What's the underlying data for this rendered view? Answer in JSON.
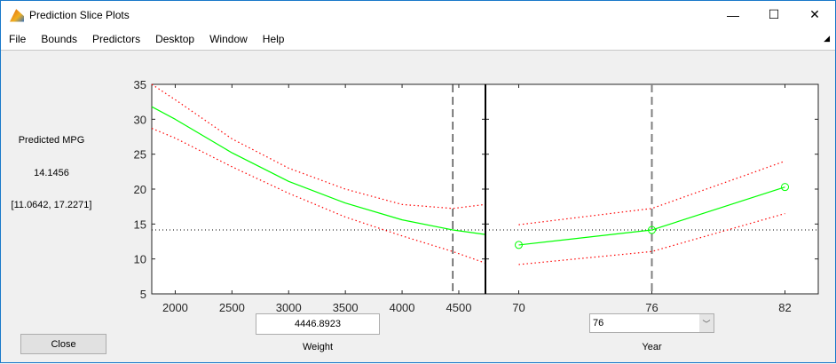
{
  "window": {
    "title": "Prediction Slice Plots",
    "minimize": "—",
    "maximize": "☐",
    "close": "✕"
  },
  "menu": [
    "File",
    "Bounds",
    "Predictors",
    "Desktop",
    "Window",
    "Help"
  ],
  "left_panel": {
    "label": "Predicted MPG",
    "value": "14.1456",
    "interval": "[11.0642, 17.2271]",
    "close_button": "Close"
  },
  "controls": {
    "weight_value": "4446.8923",
    "weight_label": "Weight",
    "year_value": "76",
    "year_label": "Year"
  },
  "chart_data": [
    {
      "type": "line",
      "xlabel": "Weight",
      "xlim": [
        1793,
        4735
      ],
      "ylim": [
        5,
        35
      ],
      "xticks": [
        2000,
        2500,
        3000,
        3500,
        4000,
        4500
      ],
      "yticks": [
        5,
        10,
        15,
        20,
        25,
        30,
        35
      ],
      "current_x": 4446.8923,
      "current_y": 14.1456,
      "x": [
        1793,
        2000,
        2500,
        3000,
        3500,
        4000,
        4447,
        4735
      ],
      "series": [
        {
          "name": "prediction",
          "values": [
            31.8,
            30.0,
            25.2,
            21.1,
            18.0,
            15.6,
            14.15,
            13.5
          ],
          "color": "#00ff00"
        },
        {
          "name": "upper bound",
          "values": [
            35.0,
            32.8,
            27.2,
            23.0,
            20.0,
            17.8,
            17.23,
            17.8
          ],
          "color": "#ff0000"
        },
        {
          "name": "lower bound",
          "values": [
            28.7,
            27.3,
            23.2,
            19.4,
            16.0,
            13.3,
            11.06,
            9.4
          ],
          "color": "#ff0000"
        }
      ]
    },
    {
      "type": "line",
      "xlabel": "Year",
      "xlim": [
        68.5,
        83.5
      ],
      "ylim": [
        5,
        35
      ],
      "xticks": [
        70,
        76,
        82
      ],
      "current_x": 76,
      "current_y": 14.1456,
      "x": [
        70,
        76,
        82
      ],
      "series": [
        {
          "name": "prediction",
          "values": [
            12.0,
            14.15,
            20.3
          ],
          "color": "#00ff00"
        },
        {
          "name": "upper bound",
          "values": [
            14.9,
            17.23,
            24.0
          ],
          "color": "#ff0000"
        },
        {
          "name": "lower bound",
          "values": [
            9.2,
            11.06,
            16.5
          ],
          "color": "#ff0000"
        }
      ]
    }
  ]
}
